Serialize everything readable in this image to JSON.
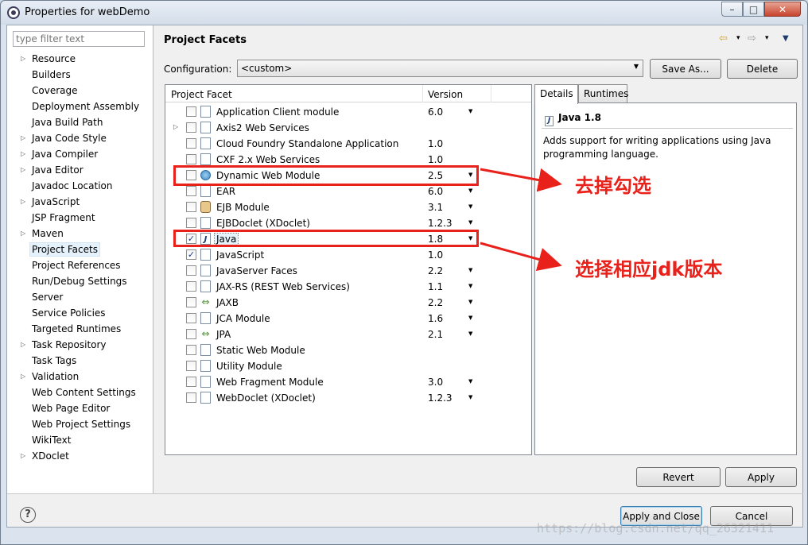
{
  "window": {
    "title": "Properties for webDemo",
    "controls": {
      "minimize": "–",
      "maximize": "□",
      "close": "✕"
    }
  },
  "sidebar": {
    "filter_placeholder": "type filter text",
    "items": [
      {
        "label": "Resource",
        "expandable": true
      },
      {
        "label": "Builders",
        "expandable": false
      },
      {
        "label": "Coverage",
        "expandable": false
      },
      {
        "label": "Deployment Assembly",
        "expandable": false
      },
      {
        "label": "Java Build Path",
        "expandable": false
      },
      {
        "label": "Java Code Style",
        "expandable": true
      },
      {
        "label": "Java Compiler",
        "expandable": true
      },
      {
        "label": "Java Editor",
        "expandable": true
      },
      {
        "label": "Javadoc Location",
        "expandable": false
      },
      {
        "label": "JavaScript",
        "expandable": true
      },
      {
        "label": "JSP Fragment",
        "expandable": false
      },
      {
        "label": "Maven",
        "expandable": true
      },
      {
        "label": "Project Facets",
        "expandable": false,
        "selected": true
      },
      {
        "label": "Project References",
        "expandable": false
      },
      {
        "label": "Run/Debug Settings",
        "expandable": false
      },
      {
        "label": "Server",
        "expandable": false
      },
      {
        "label": "Service Policies",
        "expandable": false
      },
      {
        "label": "Targeted Runtimes",
        "expandable": false
      },
      {
        "label": "Task Repository",
        "expandable": true
      },
      {
        "label": "Task Tags",
        "expandable": false
      },
      {
        "label": "Validation",
        "expandable": true
      },
      {
        "label": "Web Content Settings",
        "expandable": false
      },
      {
        "label": "Web Page Editor",
        "expandable": false
      },
      {
        "label": "Web Project Settings",
        "expandable": false
      },
      {
        "label": "WikiText",
        "expandable": false
      },
      {
        "label": "XDoclet",
        "expandable": true
      }
    ]
  },
  "page": {
    "title": "Project Facets",
    "nav": {
      "back": "⇦",
      "forward": "⇨",
      "dropdown": "▾",
      "menu": "▼"
    }
  },
  "configuration": {
    "label": "Configuration:",
    "value": "<custom>",
    "save_as": "Save As...",
    "delete": "Delete"
  },
  "facets": {
    "columns": [
      "Project Facet",
      "Version"
    ],
    "rows": [
      {
        "name": "Application Client module",
        "version": "6.0",
        "checked": false,
        "dropdown": true,
        "icon": "doc",
        "expandable": false
      },
      {
        "name": "Axis2 Web Services",
        "version": "",
        "checked": false,
        "dropdown": false,
        "icon": "doc",
        "expandable": true
      },
      {
        "name": "Cloud Foundry Standalone Application",
        "version": "1.0",
        "checked": false,
        "dropdown": false,
        "icon": "doc",
        "expandable": false
      },
      {
        "name": "CXF 2.x Web Services",
        "version": "1.0",
        "checked": false,
        "dropdown": false,
        "icon": "doc",
        "expandable": false
      },
      {
        "name": "Dynamic Web Module",
        "version": "2.5",
        "checked": false,
        "dropdown": true,
        "icon": "globe",
        "expandable": false
      },
      {
        "name": "EAR",
        "version": "6.0",
        "checked": false,
        "dropdown": true,
        "icon": "doc",
        "expandable": false
      },
      {
        "name": "EJB Module",
        "version": "3.1",
        "checked": false,
        "dropdown": true,
        "icon": "beans",
        "expandable": false
      },
      {
        "name": "EJBDoclet (XDoclet)",
        "version": "1.2.3",
        "checked": false,
        "dropdown": true,
        "icon": "doc",
        "expandable": false
      },
      {
        "name": "Java",
        "version": "1.8",
        "checked": true,
        "dropdown": true,
        "icon": "jlet",
        "expandable": false,
        "selected": true
      },
      {
        "name": "JavaScript",
        "version": "1.0",
        "checked": true,
        "dropdown": false,
        "icon": "doc",
        "expandable": false
      },
      {
        "name": "JavaServer Faces",
        "version": "2.2",
        "checked": false,
        "dropdown": true,
        "icon": "doc",
        "expandable": false
      },
      {
        "name": "JAX-RS (REST Web Services)",
        "version": "1.1",
        "checked": false,
        "dropdown": true,
        "icon": "doc",
        "expandable": false
      },
      {
        "name": "JAXB",
        "version": "2.2",
        "checked": false,
        "dropdown": true,
        "icon": "arrows",
        "expandable": false
      },
      {
        "name": "JCA Module",
        "version": "1.6",
        "checked": false,
        "dropdown": true,
        "icon": "doc",
        "expandable": false
      },
      {
        "name": "JPA",
        "version": "2.1",
        "checked": false,
        "dropdown": true,
        "icon": "arrows",
        "expandable": false
      },
      {
        "name": "Static Web Module",
        "version": "",
        "checked": false,
        "dropdown": false,
        "icon": "doc",
        "expandable": false
      },
      {
        "name": "Utility Module",
        "version": "",
        "checked": false,
        "dropdown": false,
        "icon": "doc",
        "expandable": false
      },
      {
        "name": "Web Fragment Module",
        "version": "3.0",
        "checked": false,
        "dropdown": true,
        "icon": "doc",
        "expandable": false
      },
      {
        "name": "WebDoclet (XDoclet)",
        "version": "1.2.3",
        "checked": false,
        "dropdown": true,
        "icon": "doc",
        "expandable": false
      }
    ]
  },
  "details": {
    "tabs": [
      "Details",
      "Runtimes"
    ],
    "title": "Java 1.8",
    "description": "Adds support for writing applications using Java programming language."
  },
  "buttons": {
    "revert": "Revert",
    "apply": "Apply",
    "apply_close": "Apply and Close",
    "cancel": "Cancel",
    "help": "?"
  },
  "annotations": {
    "uncheck": "去掉勾选",
    "select_jdk": "选择相应jdk版本",
    "color": "#e8211b"
  },
  "watermark": "https://blog.csdn.net/qq_26321411"
}
